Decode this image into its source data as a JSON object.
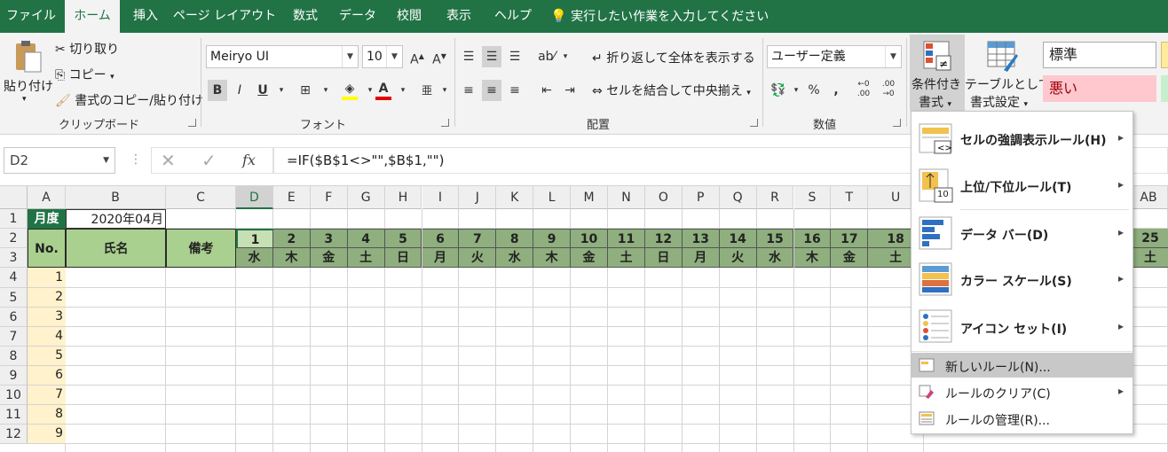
{
  "tabs": [
    "ファイル",
    "ホーム",
    "挿入",
    "ページ レイアウト",
    "数式",
    "データ",
    "校閲",
    "表示",
    "ヘルプ"
  ],
  "tell_me": "実行したい作業を入力してください",
  "clipboard": {
    "paste": "貼り付け",
    "cut": "切り取り",
    "copy": "コピー",
    "format_painter": "書式のコピー/貼り付け",
    "group": "クリップボード"
  },
  "font": {
    "name": "Meiryo UI",
    "size": "10",
    "bold": "B",
    "italic": "I",
    "underline": "U",
    "group": "フォント"
  },
  "alignment": {
    "wrap": "折り返して全体を表示する",
    "merge": "セルを結合して中央揃え",
    "group": "配置"
  },
  "number": {
    "format": "ユーザー定義",
    "group": "数値"
  },
  "styles": {
    "cond_format_1": "条件付き",
    "cond_format_2": "書式",
    "table_1": "テーブルとして",
    "table_2": "書式設定",
    "normal": "標準",
    "bad": "悪い"
  },
  "formula_bar": {
    "name_box": "D2",
    "fx": "fx",
    "formula": "=IF($B$1<>\"\",$B$1,\"\")"
  },
  "columns": [
    "A",
    "B",
    "C",
    "D",
    "E",
    "F",
    "G",
    "H",
    "I",
    "J",
    "K",
    "L",
    "M",
    "N",
    "O",
    "P",
    "Q",
    "R",
    "S",
    "T",
    "U",
    "AB"
  ],
  "rows": [
    "1",
    "2",
    "3",
    "4",
    "5",
    "6",
    "7",
    "8",
    "9",
    "10",
    "11",
    "12"
  ],
  "sheet": {
    "month_label": "月度",
    "month_value": "2020年04月",
    "no_header": "No.",
    "name_header": "氏名",
    "note_header": "備考",
    "days": [
      "1",
      "2",
      "3",
      "4",
      "5",
      "6",
      "7",
      "8",
      "9",
      "10",
      "11",
      "12",
      "13",
      "14",
      "15",
      "16",
      "17",
      "18"
    ],
    "weekdays": [
      "水",
      "木",
      "金",
      "土",
      "日",
      "月",
      "火",
      "水",
      "木",
      "金",
      "土",
      "日",
      "月",
      "火",
      "水",
      "木",
      "金",
      "土"
    ],
    "day_ab": "25",
    "weekday_ab": "土",
    "numbers": [
      "1",
      "2",
      "3",
      "4",
      "5",
      "6",
      "7",
      "8",
      "9"
    ]
  },
  "menu": {
    "items": [
      {
        "label": "セルの強調表示ルール(H)",
        "submenu": true
      },
      {
        "label": "上位/下位ルール(T)",
        "submenu": true
      },
      {
        "label": "データ バー(D)",
        "submenu": true
      },
      {
        "label": "カラー スケール(S)",
        "submenu": true
      },
      {
        "label": "アイコン セット(I)",
        "submenu": true
      }
    ],
    "small_items": [
      {
        "label": "新しいルール(N)...",
        "submenu": false
      },
      {
        "label": "ルールのクリア(C)",
        "submenu": true
      },
      {
        "label": "ルールの管理(R)...",
        "submenu": false
      }
    ],
    "top_bottom_icon_text": "10"
  },
  "colors": {
    "excel_green": "#217346",
    "header_green": "#a9d08e",
    "day_green": "#8faf7e",
    "number_yellow": "#fff2cc"
  }
}
